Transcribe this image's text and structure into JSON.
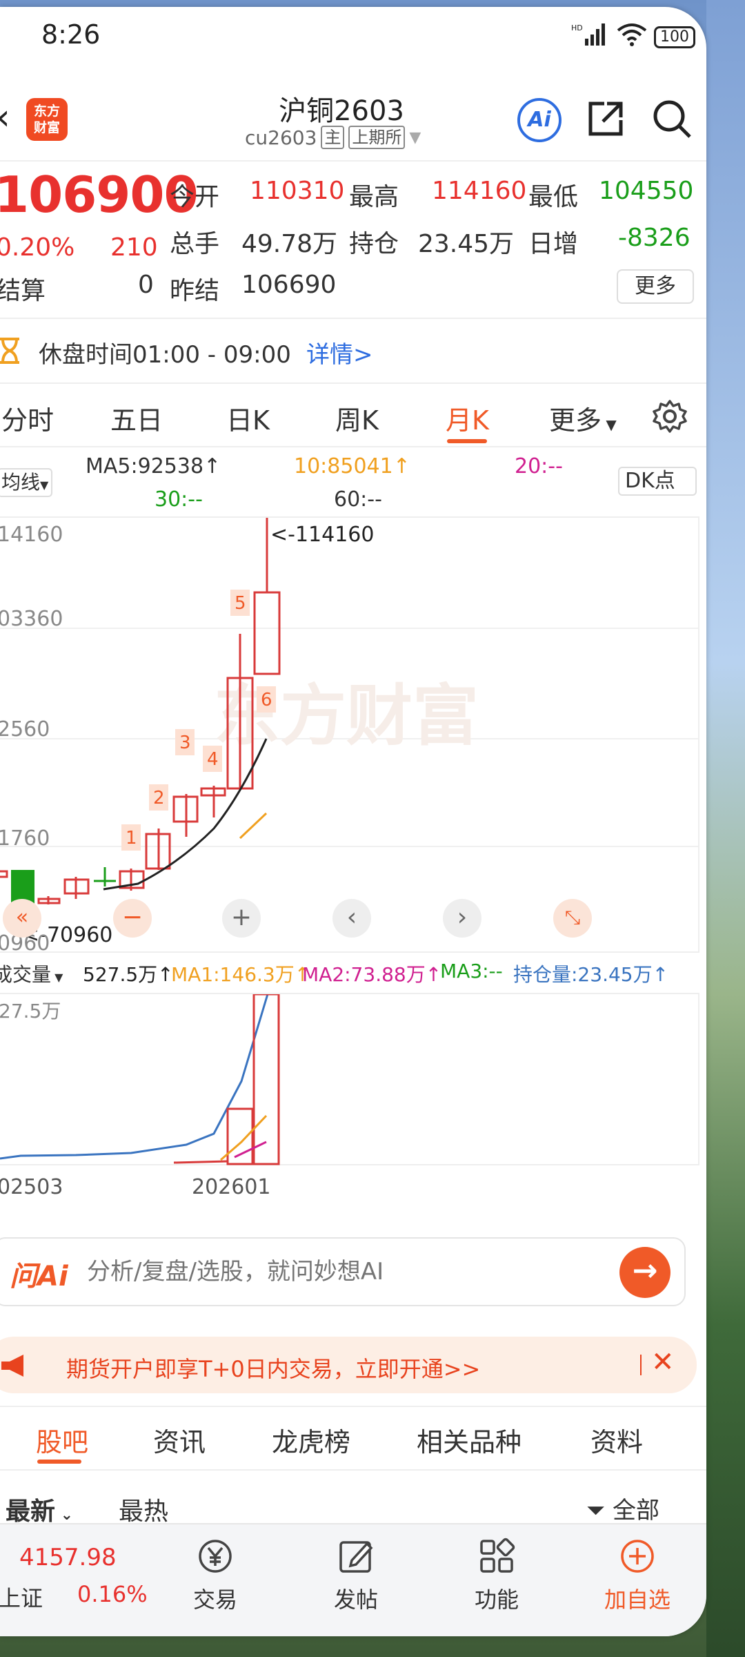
{
  "status": {
    "time": "8:26",
    "signal": "HD",
    "battery": "100"
  },
  "header": {
    "logo": "东方财富",
    "title": "沪铜2603",
    "code": "cu2603",
    "tag_main": "主",
    "exchange": "上期所"
  },
  "quote": {
    "price": "106900",
    "pct": "0.20%",
    "change": "210",
    "settle_label": "结算",
    "settle_value": "0",
    "open_label": "今开",
    "open_value": "110310",
    "high_label": "最高",
    "high_value": "114160",
    "low_label": "最低",
    "low_value": "104550",
    "volume_label": "总手",
    "volume_value": "49.78万",
    "oi_label": "持仓",
    "oi_value": "23.45万",
    "daily_inc_label": "日增",
    "daily_inc_value": "-8326",
    "prev_settle_label": "昨结",
    "prev_settle_value": "106690",
    "more": "更多"
  },
  "notice": {
    "text": "休盘时间01:00 - 09:00",
    "link": "详情>"
  },
  "tabs": [
    "分时",
    "五日",
    "日K",
    "周K",
    "月K",
    "更多"
  ],
  "ma": {
    "type": "均线",
    "ma5": "MA5:92538↑",
    "ma10": "10:85041↑",
    "ma20": "20:--",
    "ma30": "30:--",
    "ma60": "60:--",
    "dk": "DK点"
  },
  "kchart": {
    "max_label": "<-114160",
    "min_label": "<-70960",
    "y_ticks": [
      "14160",
      "03360",
      "2560",
      "1760",
      "0960"
    ],
    "markers": [
      "1",
      "2",
      "3",
      "4",
      "5",
      "6"
    ],
    "watermark": "东方财富"
  },
  "volume": {
    "type": "成交量",
    "value": "527.5万↑",
    "ma1": "MA1:146.3万↑",
    "ma2": "MA2:73.88万↑",
    "ma3": "MA3:--",
    "oi": "持仓量:23.45万↑",
    "y_top": "27.5万",
    "dates": [
      "02503",
      "202601"
    ]
  },
  "ai": {
    "logo": "问Ai",
    "placeholder": "分析/复盘/选股，就问妙想AI"
  },
  "promo": {
    "text": "期货开户即享T+0日内交易，立即开通>>"
  },
  "bottom_tabs": [
    "股吧",
    "资讯",
    "龙虎榜",
    "相关品种",
    "资料"
  ],
  "sort": {
    "newest": "最新",
    "hottest": "最热",
    "filter": "全部"
  },
  "index": {
    "value": "4157.98",
    "name": "上证",
    "pct": "0.16%"
  },
  "nav": [
    "交易",
    "发帖",
    "功能",
    "加自选"
  ]
}
